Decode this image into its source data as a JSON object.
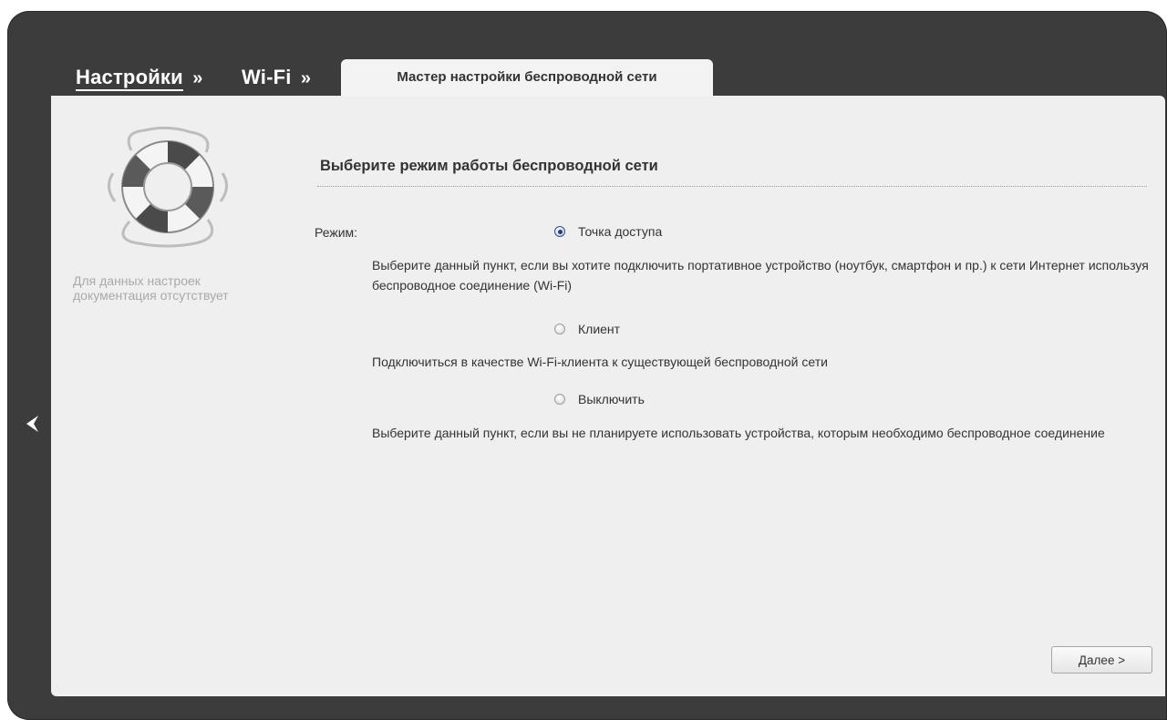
{
  "breadcrumb": {
    "settings": "Настройки",
    "separator": "»",
    "wifi": "Wi-Fi"
  },
  "tab": {
    "label": "Мастер настройки беспроводной сети"
  },
  "help": {
    "text": "Для данных настроек документация отсутствует",
    "icon": "lifebuoy-icon"
  },
  "main": {
    "title": "Выберите режим работы беспроводной сети",
    "mode_label": "Режим:",
    "options": [
      {
        "label": "Точка доступа",
        "checked": true,
        "description": "Выберите данный пункт, если вы хотите подключить портативное устройство (ноутбук, смартфон и пр.) к сети Интернет используя беспроводное соединение (Wi-Fi)"
      },
      {
        "label": "Клиент",
        "checked": false,
        "description": "Подключиться в качестве Wi-Fi-клиента к существующей беспроводной сети"
      },
      {
        "label": "Выключить",
        "checked": false,
        "description": "Выберите данный пункт, если вы не планируете использовать устройства, которым необходимо беспроводное соединение"
      }
    ],
    "next_label": "Далее >"
  },
  "nav": {
    "back_icon": "chevron-left-icon"
  },
  "colors": {
    "frame": "#3c3c3c",
    "panel": "#efefef",
    "radio_accent": "#1f3f7a"
  }
}
